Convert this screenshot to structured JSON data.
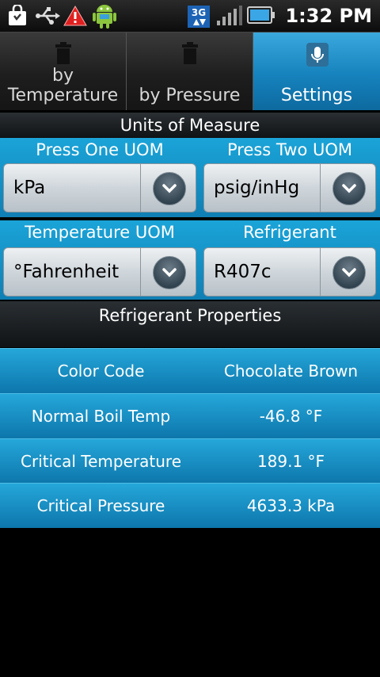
{
  "status_bar": {
    "time": "1:32 PM",
    "network_label": "3G",
    "icons": [
      "shopping-bag-icon",
      "usb-icon",
      "warning-icon",
      "android-icon",
      "3g-icon",
      "signal-icon",
      "battery-icon"
    ]
  },
  "tabs": [
    {
      "label": "by Temperature",
      "icon": "trash-icon",
      "active": false
    },
    {
      "label": "by Pressure",
      "icon": "trash-icon",
      "active": false
    },
    {
      "label": "Settings",
      "icon": "microphone-icon",
      "active": true
    }
  ],
  "units": {
    "title": "Units of Measure",
    "press_one_label": "Press One UOM",
    "press_two_label": "Press Two UOM",
    "press_one_value": "kPa",
    "press_two_value": "psig/inHg",
    "temp_label": "Temperature UOM",
    "refrigerant_label": "Refrigerant",
    "temp_value": "°Fahrenheit",
    "refrigerant_value": "R407c"
  },
  "properties": {
    "title": "Refrigerant Properties",
    "rows": [
      {
        "name": "Color Code",
        "value": "Chocolate Brown"
      },
      {
        "name": "Normal Boil Temp",
        "value": "-46.8 °F"
      },
      {
        "name": "Critical Temperature",
        "value": "189.1 °F"
      },
      {
        "name": "Critical Pressure",
        "value": "4633.3 kPa"
      }
    ]
  },
  "colors": {
    "accent": "#1682bd",
    "band": "#1ba4d8",
    "warning": "#e02020",
    "android": "#8cc63e"
  }
}
